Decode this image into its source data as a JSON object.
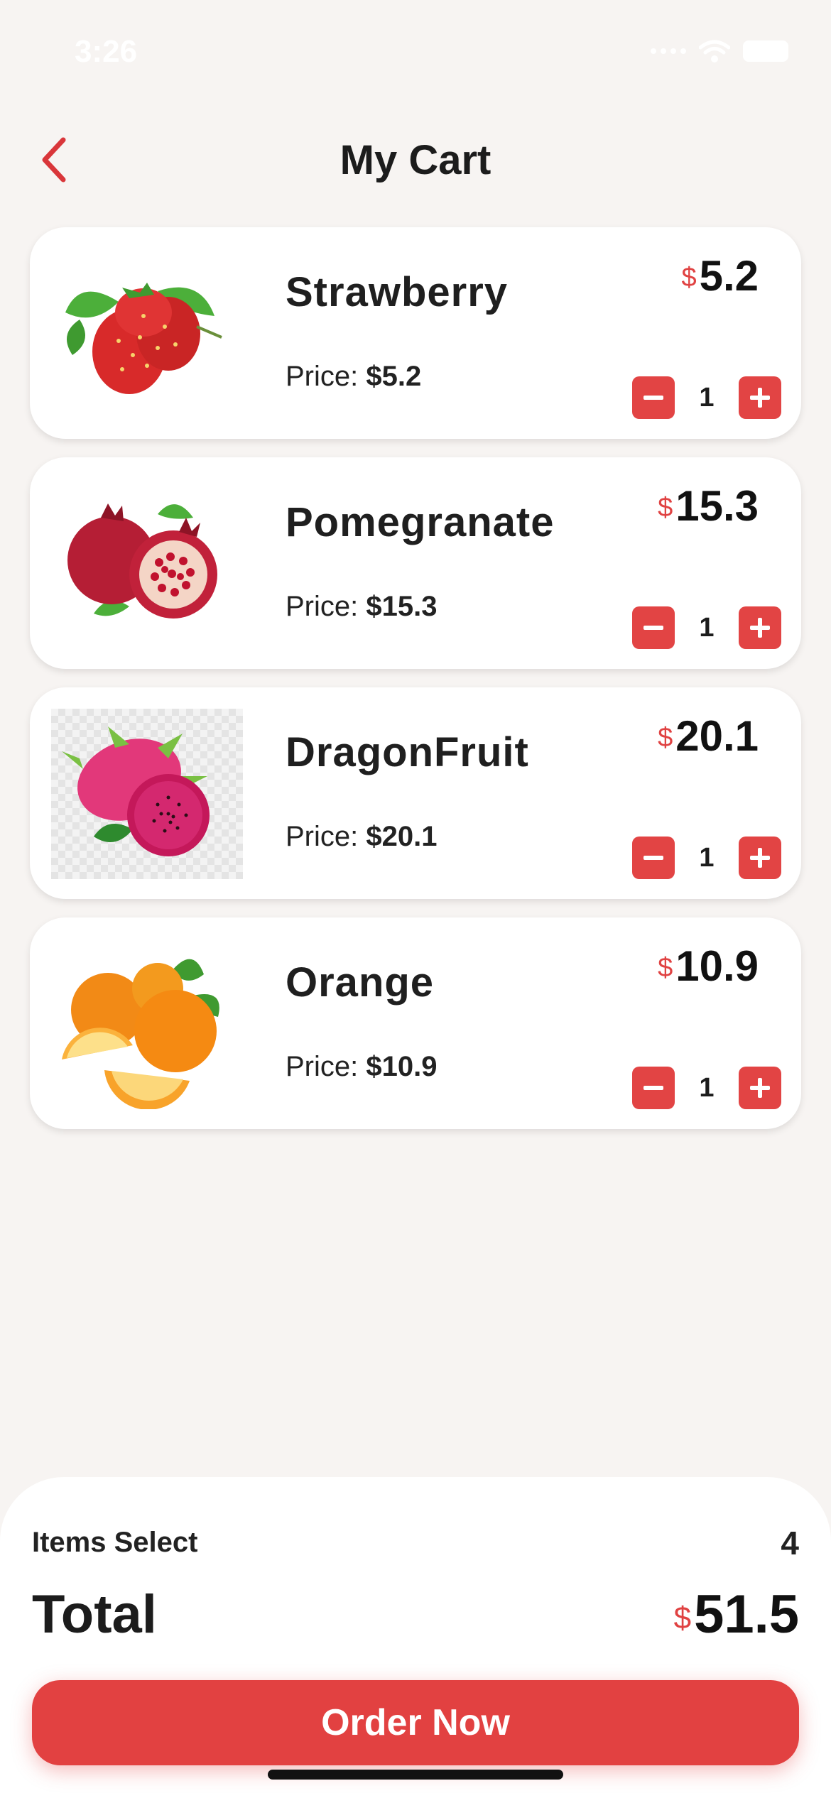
{
  "status_bar": {
    "time": "3:26"
  },
  "header": {
    "title": "My Cart",
    "back_icon": "chevron-left-icon"
  },
  "items": [
    {
      "name": "Strawberry",
      "price_label": "Price:",
      "price": "$5.2",
      "currency": "$",
      "total": "5.2",
      "qty": "1"
    },
    {
      "name": "Pomegranate",
      "price_label": "Price:",
      "price": "$15.3",
      "currency": "$",
      "total": "15.3",
      "qty": "1"
    },
    {
      "name": "DragonFruit",
      "price_label": "Price:",
      "price": "$20.1",
      "currency": "$",
      "total": "20.1",
      "qty": "1"
    },
    {
      "name": "Orange",
      "price_label": "Price:",
      "price": "$10.9",
      "currency": "$",
      "total": "10.9",
      "qty": "1"
    }
  ],
  "summary": {
    "items_select_label": "Items Select",
    "items_select_value": "4",
    "total_label": "Total",
    "total_currency": "$",
    "total_value": "51.5",
    "order_button": "Order Now"
  },
  "colors": {
    "accent": "#e24444",
    "background": "#f7f4f2",
    "card": "#ffffff"
  }
}
